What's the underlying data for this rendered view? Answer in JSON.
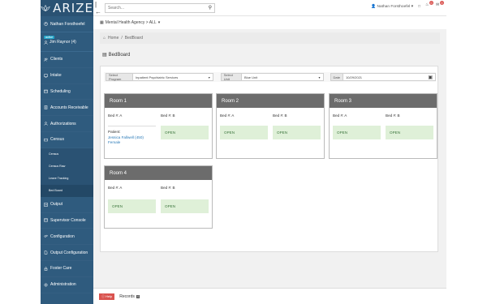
{
  "brand": {
    "name": "ARIZE"
  },
  "topbar": {
    "search_placeholder": "Search...",
    "user_name": "Nathan Forsthoefel",
    "notif_count_1": "0",
    "notif_count_2": "0"
  },
  "sidebar": {
    "user": "Nathan Forsthoefel",
    "client_status": "active",
    "client_name": "Jim Raynor (4)",
    "items": [
      {
        "label": "Clients",
        "icon": "users-icon"
      },
      {
        "label": "Intake",
        "icon": "monitor-icon"
      },
      {
        "label": "Scheduling",
        "icon": "calendar-icon"
      },
      {
        "label": "Accounts Receivable",
        "icon": "document-icon"
      },
      {
        "label": "Authorizations",
        "icon": "group-icon"
      },
      {
        "label": "Census",
        "icon": "census-icon"
      }
    ],
    "census_sub": [
      "Census",
      "Census Raw",
      "Leave Tracking",
      "Bed Board"
    ],
    "items_after": [
      {
        "label": "Output",
        "icon": "output-icon"
      },
      {
        "label": "Supervisor Console",
        "icon": "console-icon"
      },
      {
        "label": "Configuration",
        "icon": "gears-icon"
      },
      {
        "label": "Output Configuration",
        "icon": "file-icon"
      },
      {
        "label": "Foster Care",
        "icon": "lock-icon"
      },
      {
        "label": "Administration",
        "icon": "admin-icon"
      }
    ]
  },
  "agency": {
    "label": "Mental Health Agency > ALL"
  },
  "breadcrumb": {
    "home": "Home",
    "separator": "/",
    "current": "BedBoard"
  },
  "page": {
    "title": "BedBoard"
  },
  "filters": {
    "program_label": "Select Program",
    "program_value": "Inpatient Psychiatric Services",
    "unit_label": "Select Unit",
    "unit_value": "Blue Unit",
    "date_label": "Date",
    "date_value": "10/29/2021"
  },
  "rooms": [
    {
      "name": "Room 1",
      "beds": [
        {
          "label": "Bed #: A",
          "status": "occupied",
          "patient_label": "Patient:",
          "patient_name": "Jessica Fallwell (450)",
          "gender": "Female"
        },
        {
          "label": "Bed #: B",
          "status": "OPEN"
        }
      ]
    },
    {
      "name": "Room 2",
      "beds": [
        {
          "label": "Bed #: A",
          "status": "OPEN"
        },
        {
          "label": "Bed #: B",
          "status": "OPEN"
        }
      ]
    },
    {
      "name": "Room 3",
      "beds": [
        {
          "label": "Bed #: A",
          "status": "OPEN"
        },
        {
          "label": "Bed #: B",
          "status": "OPEN"
        }
      ]
    },
    {
      "name": "Room 4",
      "beds": [
        {
          "label": "Bed #: A",
          "status": "OPEN"
        },
        {
          "label": "Bed #: B",
          "status": "OPEN"
        }
      ]
    }
  ],
  "footer": {
    "help_label": "Help",
    "records_label": "Records",
    "records_count": "0"
  }
}
